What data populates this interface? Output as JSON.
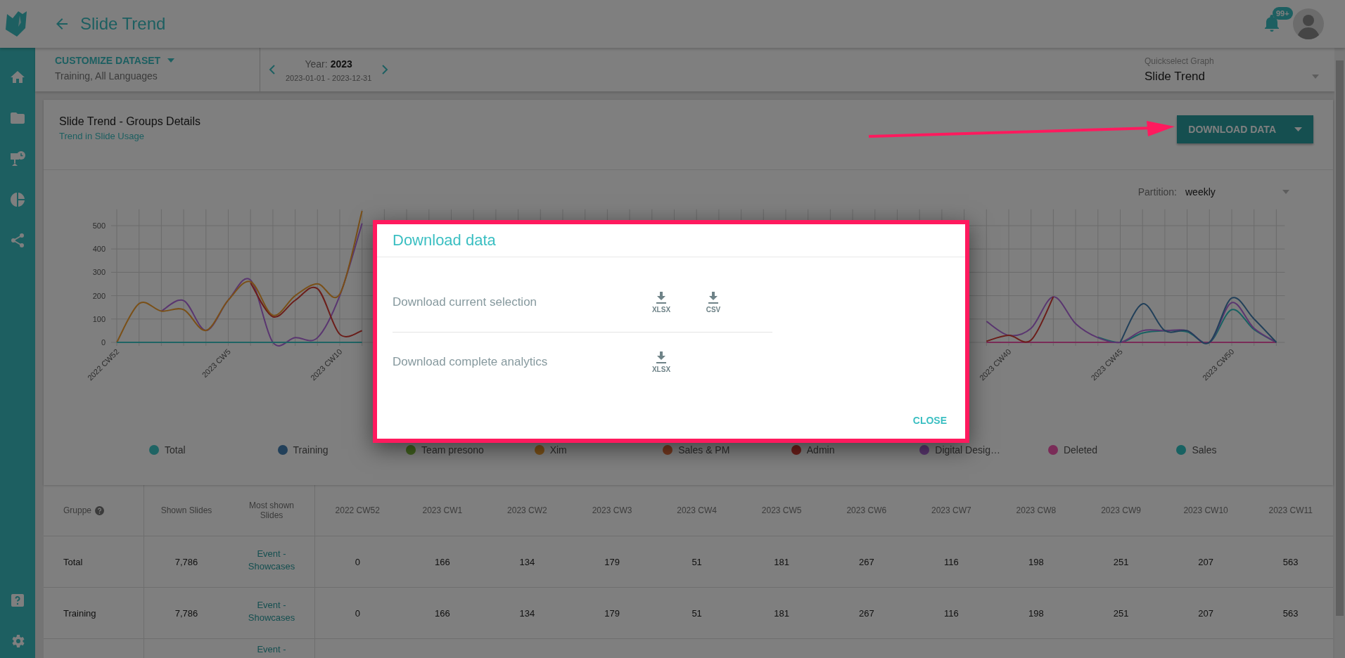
{
  "header": {
    "title": "Slide Trend",
    "notifications_badge": "99+"
  },
  "toolbar": {
    "dataset_button": "CUSTOMIZE DATASET",
    "dataset_summary": "Training, All Languages",
    "year_label": "Year:",
    "year": "2023",
    "date_range": "2023-01-01 - 2023-12-31",
    "quickselect_label": "Quickselect Graph",
    "quickselect_value": "Slide Trend"
  },
  "card": {
    "title": "Slide Trend - Groups Details",
    "subtitle": "Trend in Slide Usage",
    "download_button": "DOWNLOAD DATA",
    "partition_label": "Partition:",
    "partition_value": "weekly",
    "chart_data": {
      "type": "line",
      "categories": [
        "2022 CW52",
        null,
        null,
        null,
        null,
        "2023 CW5",
        null,
        null,
        null,
        null,
        "2023 CW10",
        null,
        null,
        null,
        null,
        null,
        null,
        null,
        null,
        null,
        null,
        null,
        null,
        null,
        null,
        null,
        null,
        null,
        null,
        null,
        null,
        null,
        null,
        null,
        null,
        null,
        null,
        null,
        null,
        null,
        "2023 CW40",
        null,
        null,
        null,
        null,
        "2023 CW45",
        null,
        null,
        null,
        null,
        "2023 CW50",
        null,
        null
      ],
      "yticks": [
        0,
        100,
        200,
        300,
        400,
        500
      ],
      "ylim": [
        0,
        570
      ],
      "grid": true,
      "series": [
        {
          "name": "Total",
          "color": "#1f6464",
          "values": [
            0,
            0,
            0,
            0,
            0,
            0,
            0,
            0,
            0,
            0,
            0,
            0,
            null,
            null,
            null,
            null,
            null,
            null,
            null,
            null,
            null,
            null,
            null,
            null,
            null,
            null,
            null,
            null,
            null,
            null,
            null,
            null,
            null,
            null,
            null,
            null,
            null,
            null,
            null,
            null,
            null,
            null,
            null,
            null,
            null,
            null,
            null,
            null,
            null,
            null,
            null,
            null,
            null
          ]
        },
        {
          "name": "Training",
          "color": "#22405a",
          "values": [
            null,
            null,
            null,
            null,
            null,
            null,
            null,
            null,
            null,
            null,
            null,
            null,
            null,
            null,
            null,
            null,
            null,
            null,
            null,
            null,
            null,
            null,
            null,
            null,
            null,
            null,
            null,
            null,
            null,
            null,
            null,
            null,
            null,
            null,
            null,
            null,
            null,
            null,
            null,
            null,
            null,
            null,
            null,
            null,
            null,
            0,
            165,
            50,
            50,
            0,
            190,
            100,
            0
          ]
        },
        {
          "name": "Team presono",
          "color": "#40601e",
          "values": [
            null,
            null,
            null,
            null,
            null,
            null,
            null,
            null,
            null,
            null,
            null,
            null,
            null,
            null,
            null,
            null,
            null,
            null,
            null,
            null,
            null,
            null,
            null,
            null,
            null,
            null,
            null,
            null,
            null,
            null,
            null,
            null,
            null,
            null,
            null,
            null,
            null,
            null,
            null,
            null,
            null,
            null,
            null,
            null,
            null,
            null,
            null,
            null,
            null,
            null,
            null,
            null,
            null
          ]
        },
        {
          "name": "Xim",
          "color": "#7a5018",
          "values": [
            0,
            166,
            134,
            140,
            51,
            181,
            260,
            116,
            200,
            251,
            207,
            563,
            null,
            null,
            null,
            null,
            null,
            null,
            null,
            null,
            null,
            null,
            null,
            null,
            null,
            null,
            null,
            null,
            null,
            null,
            null,
            null,
            null,
            null,
            null,
            null,
            null,
            null,
            null,
            null,
            null,
            null,
            null,
            null,
            null,
            null,
            null,
            null,
            null,
            null,
            null,
            null,
            null
          ]
        },
        {
          "name": "Sales & PM",
          "color": "#74381f",
          "values": [
            null,
            null,
            null,
            null,
            null,
            null,
            null,
            null,
            null,
            null,
            null,
            null,
            null,
            null,
            null,
            null,
            null,
            null,
            null,
            null,
            null,
            null,
            null,
            null,
            null,
            null,
            null,
            null,
            null,
            null,
            null,
            null,
            null,
            null,
            null,
            null,
            null,
            null,
            null,
            null,
            null,
            null,
            null,
            null,
            null,
            null,
            null,
            null,
            null,
            null,
            null,
            null,
            null
          ]
        },
        {
          "name": "Admin",
          "color": "#6c1e1a",
          "values": [
            null,
            null,
            null,
            null,
            null,
            null,
            255,
            110,
            180,
            230,
            35,
            50,
            null,
            null,
            null,
            null,
            null,
            null,
            null,
            null,
            null,
            null,
            null,
            null,
            null,
            null,
            null,
            null,
            null,
            null,
            null,
            null,
            null,
            null,
            null,
            null,
            null,
            null,
            null,
            5,
            30,
            10,
            195,
            null,
            null,
            null,
            null,
            null,
            null,
            null,
            null,
            null,
            null
          ]
        },
        {
          "name": "Digital Desig…",
          "color": "#5a3670",
          "values": [
            null,
            null,
            134,
            179,
            51,
            181,
            267,
            0,
            20,
            20,
            200,
            510,
            null,
            null,
            null,
            null,
            null,
            null,
            null,
            null,
            null,
            null,
            null,
            null,
            null,
            null,
            null,
            null,
            null,
            null,
            null,
            null,
            null,
            null,
            null,
            null,
            null,
            null,
            null,
            90,
            30,
            60,
            195,
            80,
            20,
            0,
            50,
            50,
            50,
            0,
            170,
            60,
            0
          ]
        },
        {
          "name": "Deleted",
          "color": "#7a2c58",
          "values": [
            null,
            null,
            null,
            null,
            null,
            null,
            null,
            null,
            null,
            null,
            null,
            null,
            null,
            null,
            null,
            null,
            null,
            null,
            null,
            null,
            null,
            null,
            null,
            null,
            null,
            null,
            null,
            null,
            null,
            null,
            null,
            null,
            null,
            null,
            null,
            null,
            null,
            null,
            null,
            0,
            0,
            0,
            0,
            0,
            0,
            0,
            0,
            0,
            0,
            0,
            0,
            0,
            0
          ]
        },
        {
          "name": "Sales",
          "color": "#186262",
          "values": [
            null,
            null,
            null,
            null,
            null,
            null,
            null,
            null,
            null,
            null,
            null,
            null,
            null,
            null,
            null,
            null,
            null,
            null,
            null,
            null,
            null,
            null,
            null,
            null,
            null,
            null,
            null,
            null,
            null,
            null,
            null,
            null,
            null,
            null,
            null,
            null,
            null,
            null,
            null,
            null,
            null,
            null,
            null,
            null,
            22,
            0,
            40,
            50,
            45,
            0,
            140,
            55,
            0
          ]
        }
      ]
    }
  },
  "table": {
    "columns": [
      "Gruppe",
      "Shown Slides",
      "Most shown Slides",
      "2022 CW52",
      "2023 CW1",
      "2023 CW2",
      "2023 CW3",
      "2023 CW4",
      "2023 CW5",
      "2023 CW6",
      "2023 CW7",
      "2023 CW8",
      "2023 CW9",
      "2023 CW10",
      "2023 CW11"
    ],
    "rows": [
      {
        "group": "Total",
        "shown": "7,786",
        "most_shown": "Event - Showcases",
        "weeks": [
          "0",
          "166",
          "134",
          "179",
          "51",
          "181",
          "267",
          "116",
          "198",
          "251",
          "207",
          "563"
        ]
      },
      {
        "group": "Training",
        "shown": "7,786",
        "most_shown": "Event - Showcases",
        "weeks": [
          "0",
          "166",
          "134",
          "179",
          "51",
          "181",
          "267",
          "116",
          "198",
          "251",
          "207",
          "563"
        ]
      },
      {
        "most_shown": "Event -"
      }
    ]
  },
  "dialog": {
    "title": "Download data",
    "options": [
      {
        "label": "Download current selection",
        "formats": [
          "XLSX",
          "CSV"
        ]
      },
      {
        "label": "Download complete analytics",
        "formats": [
          "XLSX"
        ]
      }
    ],
    "close_button": "CLOSE"
  }
}
